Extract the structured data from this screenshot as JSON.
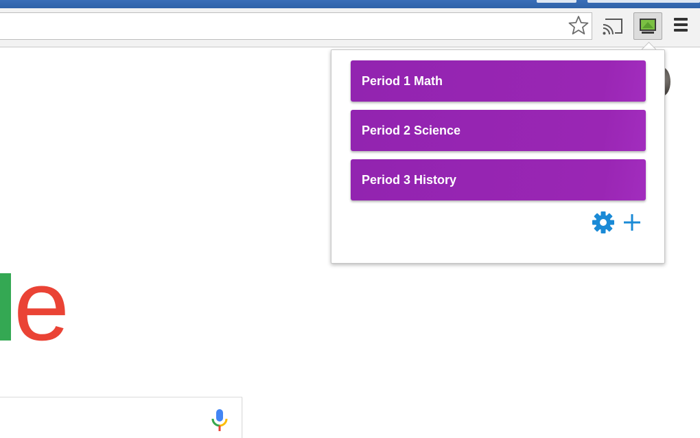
{
  "browser": {
    "toolbar_icons": [
      "star-icon",
      "cast-icon",
      "classroom-extension-icon",
      "menu-icon"
    ]
  },
  "popup": {
    "classes": [
      {
        "label": "Period 1 Math"
      },
      {
        "label": "Period 2 Science"
      },
      {
        "label": "Period 3 History"
      }
    ],
    "footer_icons": [
      "gear-icon",
      "plus-icon"
    ],
    "button_color": "#9c27b0",
    "icon_color": "#1a8ad6"
  },
  "page": {
    "logo_visible_letters": "le",
    "logo_colors": {
      "l": "#34a853",
      "e": "#ea4335"
    }
  }
}
